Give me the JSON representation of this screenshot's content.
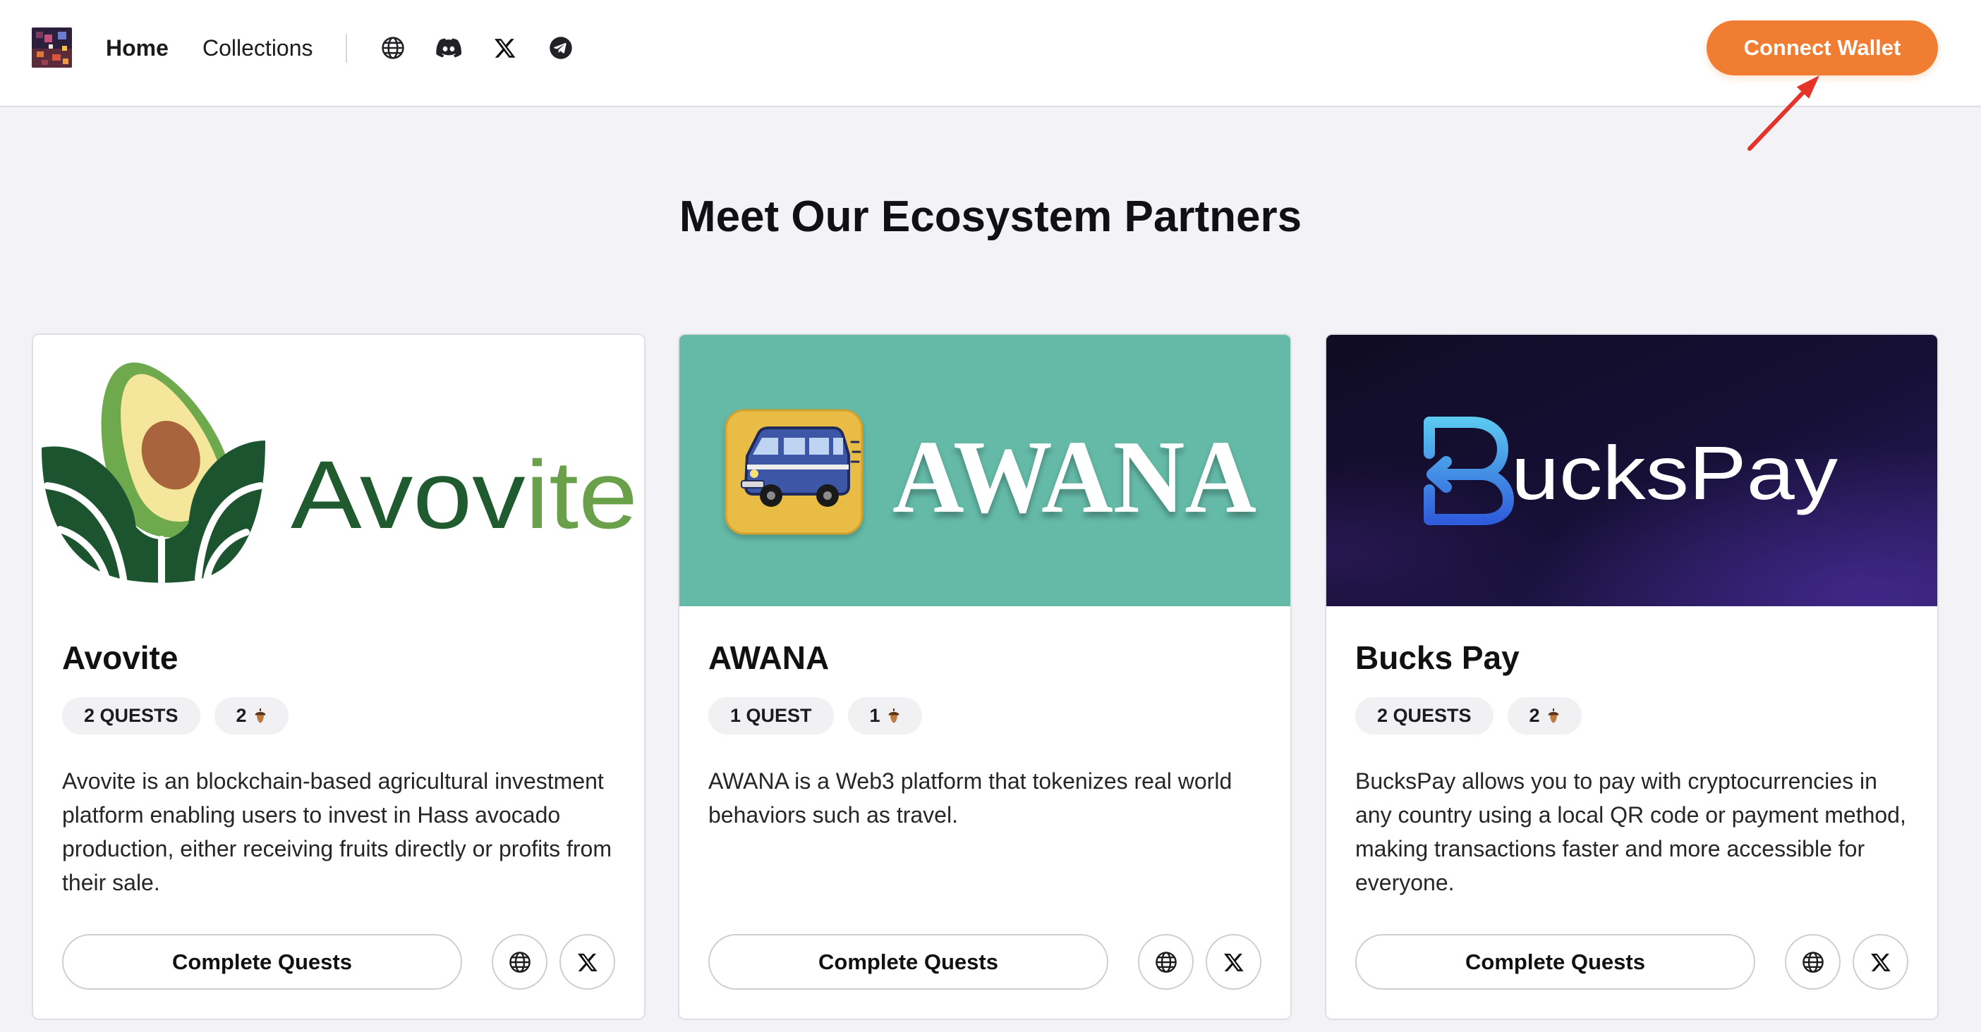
{
  "header": {
    "nav": [
      {
        "label": "Home"
      },
      {
        "label": "Collections"
      }
    ],
    "social_icons": [
      "globe-icon",
      "discord-icon",
      "x-icon",
      "telegram-icon"
    ],
    "connect_wallet_label": "Connect Wallet"
  },
  "colors": {
    "accent": "#F07D31",
    "annotation_arrow": "#E5332A",
    "page_background": "#F3F3F7",
    "awana_banner": "#64B9A7",
    "buckspay_banner": "#151030"
  },
  "page_title": "Meet Our Ecosystem Partners",
  "cards": [
    {
      "name": "Avovite",
      "logo_parts": [
        "Avov",
        "ite"
      ],
      "quests": "2 QUESTS",
      "reward": "2",
      "reward_icon": "acorn-icon",
      "description_lines": [
        "Avovite is an blockchain-based agricultural investment",
        "platform enabling users to invest in Hass avocado",
        "production, either receiving fruits directly or profits from",
        "their sale."
      ],
      "cta": "Complete Quests",
      "links": [
        "globe-icon",
        "x-icon"
      ]
    },
    {
      "name": "AWANA",
      "logo_parts": [
        "AWANA"
      ],
      "quests": "1 QUEST",
      "reward": "1",
      "reward_icon": "acorn-icon",
      "description_lines": [
        "AWANA is a Web3 platform that tokenizes real world",
        "behaviors such as travel."
      ],
      "cta": "Complete Quests",
      "links": [
        "globe-icon",
        "x-icon"
      ]
    },
    {
      "name": "Bucks Pay",
      "logo_parts": [
        "B",
        "ucksPay"
      ],
      "quests": "2 QUESTS",
      "reward": "2",
      "reward_icon": "acorn-icon",
      "description_lines": [
        "BucksPay allows you to pay with cryptocurrencies in",
        "any country using a local QR code or payment method,",
        "making transactions faster and more accessible for",
        "everyone."
      ],
      "cta": "Complete Quests",
      "links": [
        "globe-icon",
        "x-icon"
      ]
    }
  ]
}
